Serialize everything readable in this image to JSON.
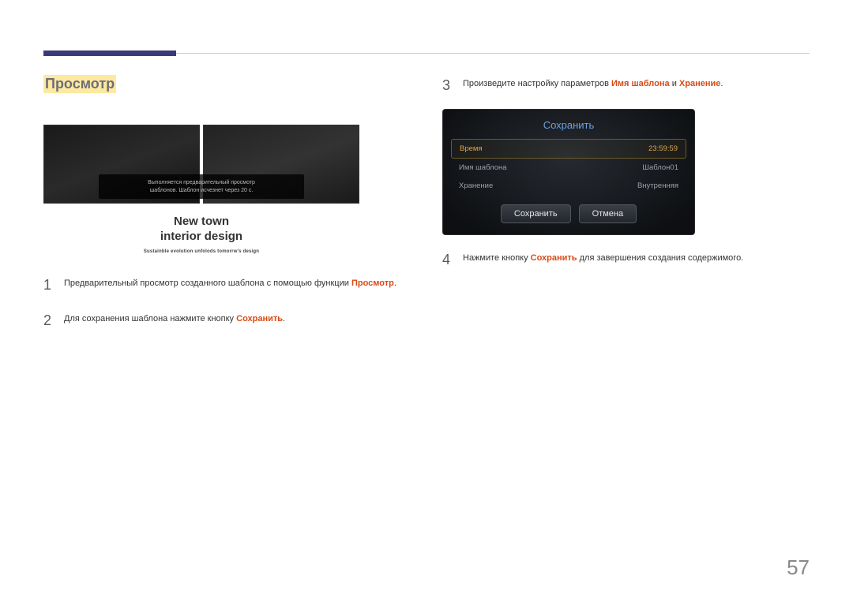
{
  "section_title": "Просмотр",
  "preview": {
    "overlay_l1": "Выполняется предварительный просмотр",
    "overlay_l2": "шаблонов. Шаблон исчезнет через 20 с.",
    "headline_l1": "New town",
    "headline_l2": "interior design",
    "subtitle": "Sustainble evolution unfolods tomorrw's design"
  },
  "steps": {
    "s1": {
      "n": "1",
      "a": "Предварительный просмотр созданного шаблона с помощью функции ",
      "em": "Просмотр",
      "b": "."
    },
    "s2": {
      "n": "2",
      "a": "Для сохранения шаблона нажмите кнопку ",
      "em": "Сохранить",
      "b": "."
    },
    "s3": {
      "n": "3",
      "a": "Произведите настройку параметров ",
      "em1": "Имя шаблона",
      "mid": " и ",
      "em2": "Хранение",
      "b": "."
    },
    "s4": {
      "n": "4",
      "a": "Нажмите кнопку ",
      "em": "Сохранить",
      "b": " для завершения создания содержимого."
    }
  },
  "dialog": {
    "title": "Сохранить",
    "rows": {
      "r0": {
        "label": "Время",
        "value": "23:59:59"
      },
      "r1": {
        "label": "Имя шаблона",
        "value": "Шаблон01"
      },
      "r2": {
        "label": "Хранение",
        "value": "Внутренняя"
      }
    },
    "btn_save": "Сохранить",
    "btn_cancel": "Отмена"
  },
  "page_number": "57"
}
